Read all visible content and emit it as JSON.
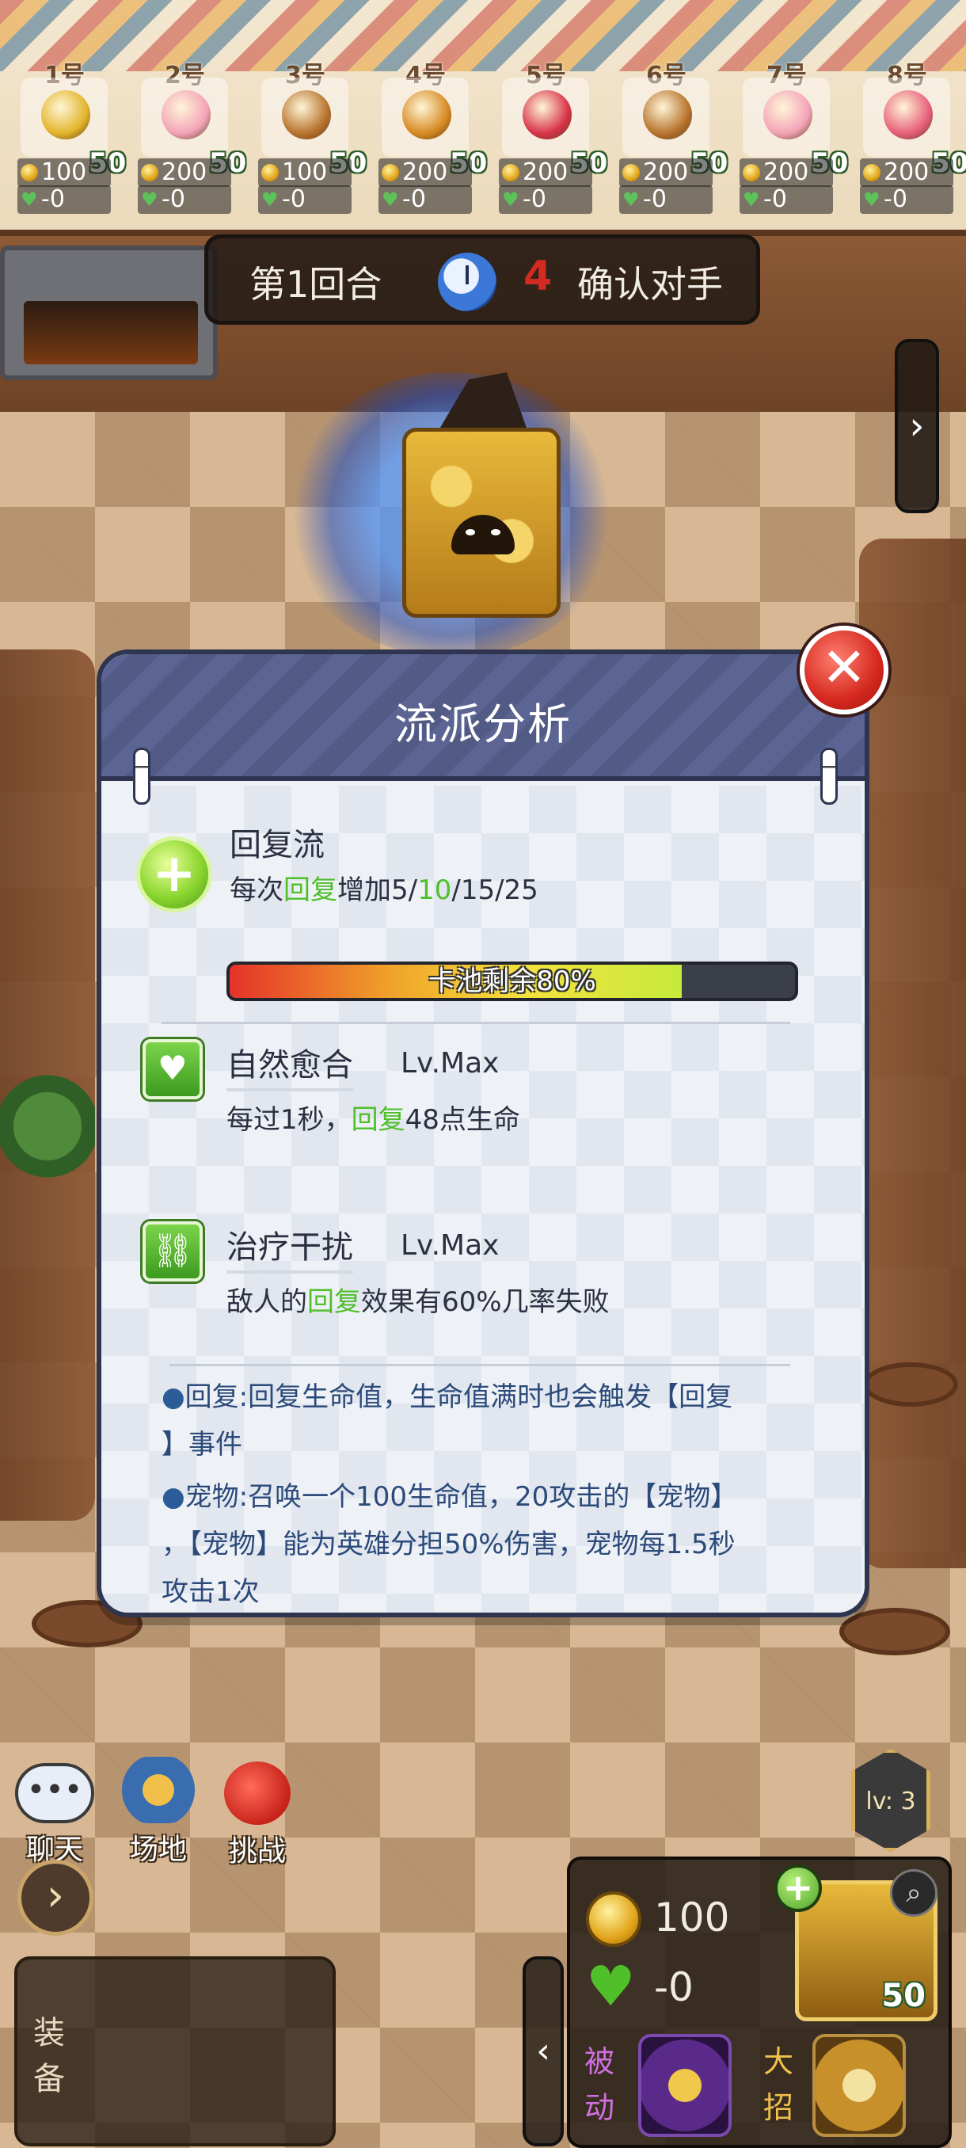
{
  "players": [
    {
      "num": "1号",
      "level": "50",
      "gold": "100",
      "hp": "-0",
      "color": "#e2b52a"
    },
    {
      "num": "2号",
      "level": "50",
      "gold": "200",
      "hp": "-0",
      "color": "#f3a3b8"
    },
    {
      "num": "3号",
      "level": "50",
      "gold": "100",
      "hp": "-0",
      "color": "#b8742e"
    },
    {
      "num": "4号",
      "level": "50",
      "gold": "200",
      "hp": "-0",
      "color": "#d88a22"
    },
    {
      "num": "5号",
      "level": "50",
      "gold": "200",
      "hp": "-0",
      "color": "#d8344a"
    },
    {
      "num": "6号",
      "level": "50",
      "gold": "200",
      "hp": "-0",
      "color": "#b8742e"
    },
    {
      "num": "7号",
      "level": "50",
      "gold": "200",
      "hp": "-0",
      "color": "#f3a3b8"
    },
    {
      "num": "8号",
      "level": "50",
      "gold": "200",
      "hp": "-0",
      "color": "#e8607a"
    }
  ],
  "round": {
    "label": "第1回合",
    "count": "4",
    "action": "确认对手"
  },
  "modal": {
    "title": "流派分析",
    "build": {
      "name": "回复流",
      "desc_prefix": "每次",
      "desc_keyword": "回复",
      "desc_mid": "增加5/",
      "desc_highlight": "10",
      "desc_suffix": "/15/25"
    },
    "pool": {
      "text": "卡池剩余80%",
      "fraction": 0.8
    },
    "skills": [
      {
        "name": "自然愈合",
        "level": "Lv.Max",
        "desc_prefix": "每过1秒，",
        "desc_keyword": "回复",
        "desc_suffix": "48点生命",
        "icon": "heart-plus-icon"
      },
      {
        "name": "治疗干扰",
        "level": "Lv.Max",
        "desc_prefix": "敌人的",
        "desc_keyword": "回复",
        "desc_suffix": "效果有60%几率失败",
        "icon": "broken-chain-icon"
      }
    ],
    "notes": [
      {
        "bullet": "●",
        "line1": "回复:回复生命值，生命值满时也会触发【回复",
        "line2": "】事件"
      },
      {
        "bullet": "●",
        "line1": "宠物:召唤一个100生命值，20攻击的【宠物】",
        "line2": "，【宠物】能为英雄分担50%伤害，宠物每1.5秒",
        "line3": "攻击1次"
      }
    ]
  },
  "hud": {
    "chat": "聊天",
    "venue": "场地",
    "challenge": "挑战",
    "equip": "装备",
    "level": "lv: 3",
    "gold": "100",
    "hp": "-0",
    "passive": "被动",
    "ultimate": "大招",
    "hero_level": "50"
  },
  "colors": {
    "highlight_green": "#4fbf2a",
    "modal_header": "#5b6492",
    "close_red": "#d5281f"
  }
}
